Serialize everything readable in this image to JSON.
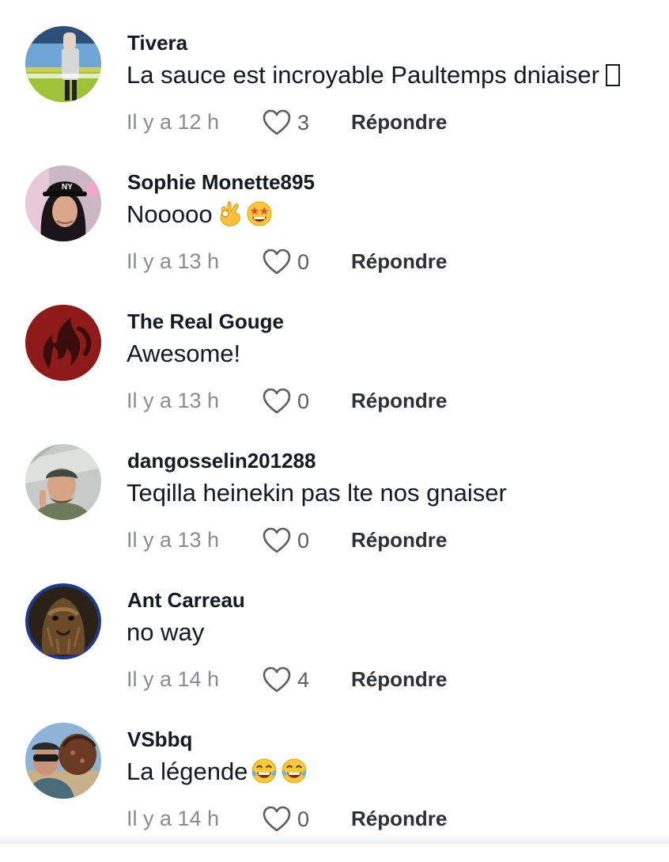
{
  "colors": {
    "username": "#161823",
    "text": "#161823",
    "timestamp": "#8a8b91",
    "reply": "#2f3036",
    "like_icon": "#5c5d63"
  },
  "comments": [
    {
      "username": "Tivera",
      "text": "La sauce est incroyable Paultemps dniaiser",
      "trailing_glyph": "missing-glyph-box",
      "time": "Il y a 12 h",
      "likes": "3",
      "reply_label": "Répondre",
      "avatar_icon": "stadium-photo-avatar"
    },
    {
      "username": "Sophie Monette895",
      "text": "Nooooo",
      "emojis": [
        "ok-hand-emoji",
        "star-struck-emoji"
      ],
      "time": "Il y a 13 h",
      "likes": "0",
      "reply_label": "Répondre",
      "avatar_icon": "woman-cap-photo-avatar"
    },
    {
      "username": "The Real Gouge",
      "text": "Awesome!",
      "time": "Il y a 13 h",
      "likes": "0",
      "reply_label": "Répondre",
      "avatar_icon": "red-flame-logo-avatar"
    },
    {
      "username": "dangosselin201288",
      "text": "Teqilla heinekin pas lte nos gnaiser",
      "time": "Il y a 13 h",
      "likes": "0",
      "reply_label": "Répondre",
      "avatar_icon": "man-selfie-photo-avatar"
    },
    {
      "username": "Ant Carreau",
      "text": "no way",
      "time": "Il y a 14 h",
      "likes": "4",
      "reply_label": "Répondre",
      "avatar_icon": "wookiee-photo-avatar"
    },
    {
      "username": "VSbbq",
      "text": "La légende",
      "emojis": [
        "tears-of-joy-emoji",
        "tears-of-joy-emoji"
      ],
      "time": "Il y a 14 h",
      "likes": "0",
      "reply_label": "Répondre",
      "avatar_icon": "man-with-brisket-photo-avatar"
    }
  ]
}
